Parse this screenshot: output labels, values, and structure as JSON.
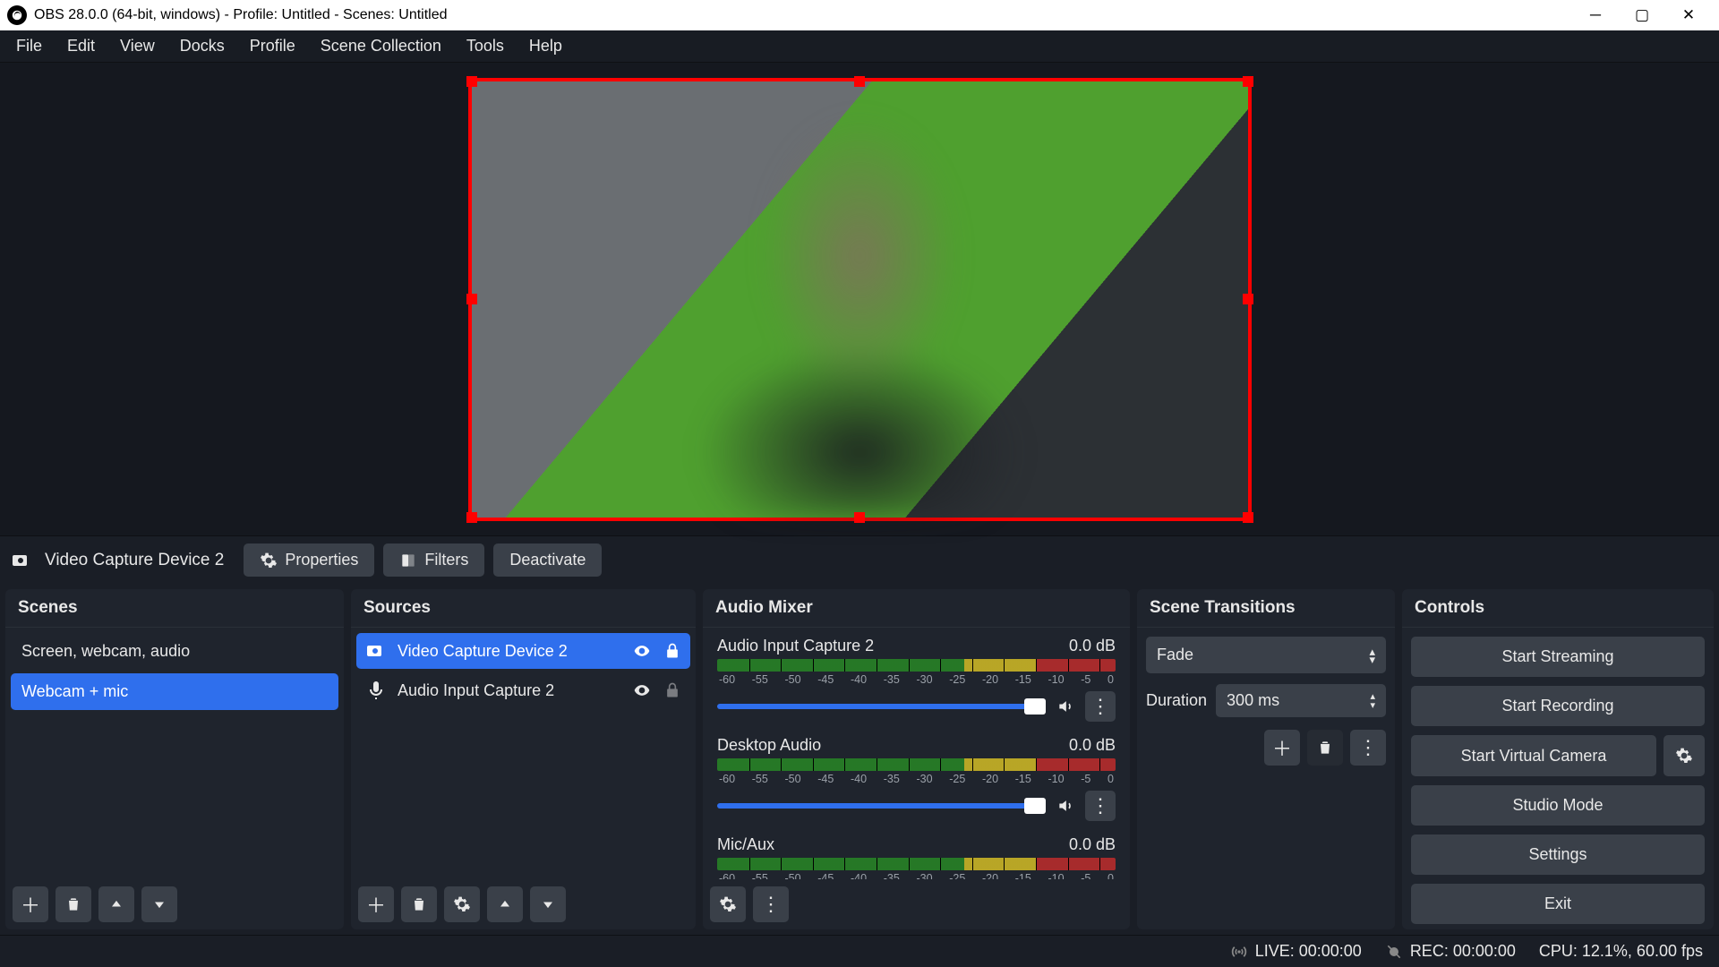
{
  "titlebar": {
    "text": "OBS 28.0.0 (64-bit, windows) - Profile: Untitled - Scenes: Untitled"
  },
  "menubar": [
    "File",
    "Edit",
    "View",
    "Docks",
    "Profile",
    "Scene Collection",
    "Tools",
    "Help"
  ],
  "selected_source_label": "Video Capture Device 2",
  "src_toolbar": {
    "properties": "Properties",
    "filters": "Filters",
    "deactivate": "Deactivate"
  },
  "panels": {
    "scenes": {
      "title": "Scenes",
      "items": [
        "Screen, webcam, audio",
        "Webcam + mic"
      ],
      "selected": 1
    },
    "sources": {
      "title": "Sources",
      "items": [
        {
          "icon": "camera",
          "label": "Video Capture Device 2",
          "selected": true,
          "locked": true
        },
        {
          "icon": "mic",
          "label": "Audio Input Capture 2",
          "selected": false,
          "locked": false
        }
      ]
    },
    "mixer": {
      "title": "Audio Mixer",
      "ticks": [
        "-60",
        "-55",
        "-50",
        "-45",
        "-40",
        "-35",
        "-30",
        "-25",
        "-20",
        "-15",
        "-10",
        "-5",
        "0"
      ],
      "channels": [
        {
          "name": "Audio Input Capture 2",
          "db": "0.0 dB"
        },
        {
          "name": "Desktop Audio",
          "db": "0.0 dB"
        },
        {
          "name": "Mic/Aux",
          "db": "0.0 dB"
        }
      ]
    },
    "transitions": {
      "title": "Scene Transitions",
      "select": "Fade",
      "duration_label": "Duration",
      "duration_value": "300 ms"
    },
    "controls": {
      "title": "Controls",
      "buttons": [
        "Start Streaming",
        "Start Recording",
        "Start Virtual Camera",
        "Studio Mode",
        "Settings",
        "Exit"
      ]
    }
  },
  "statusbar": {
    "live": "LIVE: 00:00:00",
    "rec": "REC: 00:00:00",
    "cpu": "CPU: 12.1%, 60.00 fps"
  }
}
